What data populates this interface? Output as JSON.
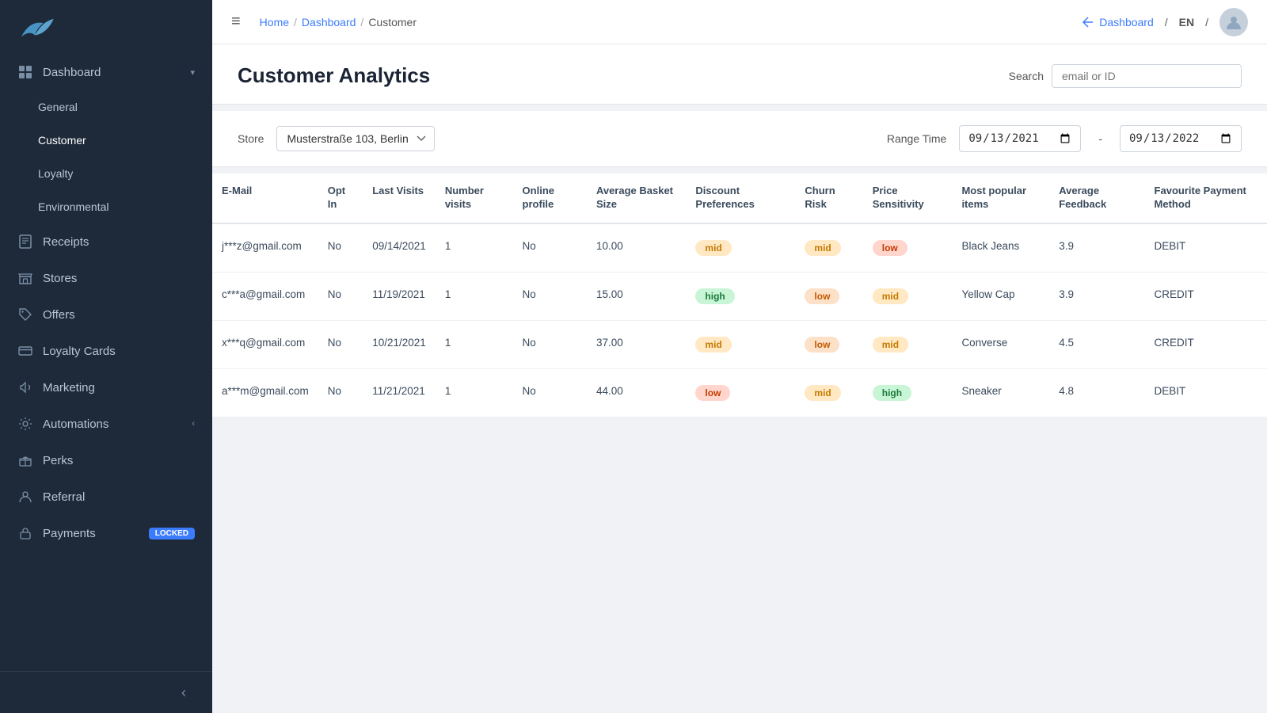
{
  "sidebar": {
    "logo_alt": "Swiftly logo",
    "nav": [
      {
        "id": "dashboard",
        "label": "Dashboard",
        "icon": "grid",
        "hasArrow": true,
        "active": false,
        "indent": 0
      },
      {
        "id": "general",
        "label": "General",
        "icon": "",
        "hasArrow": false,
        "active": false,
        "indent": 1
      },
      {
        "id": "customer",
        "label": "Customer",
        "icon": "",
        "hasArrow": false,
        "active": true,
        "indent": 1
      },
      {
        "id": "loyalty",
        "label": "Loyalty",
        "icon": "",
        "hasArrow": false,
        "active": false,
        "indent": 1
      },
      {
        "id": "environmental",
        "label": "Environmental",
        "icon": "",
        "hasArrow": false,
        "active": false,
        "indent": 1
      },
      {
        "id": "receipts",
        "label": "Receipts",
        "icon": "receipt",
        "hasArrow": false,
        "active": false,
        "indent": 0
      },
      {
        "id": "stores",
        "label": "Stores",
        "icon": "store",
        "hasArrow": false,
        "active": false,
        "indent": 0
      },
      {
        "id": "offers",
        "label": "Offers",
        "icon": "tag",
        "hasArrow": false,
        "active": false,
        "indent": 0
      },
      {
        "id": "loyalty-cards",
        "label": "Loyalty Cards",
        "icon": "card",
        "hasArrow": false,
        "active": false,
        "indent": 0
      },
      {
        "id": "marketing",
        "label": "Marketing",
        "icon": "megaphone",
        "hasArrow": false,
        "active": false,
        "indent": 0
      },
      {
        "id": "automations",
        "label": "Automations",
        "icon": "settings2",
        "hasArrow": true,
        "active": false,
        "indent": 0
      },
      {
        "id": "perks",
        "label": "Perks",
        "icon": "gift",
        "hasArrow": false,
        "active": false,
        "indent": 0
      },
      {
        "id": "referral",
        "label": "Referral",
        "icon": "person",
        "hasArrow": false,
        "active": false,
        "indent": 0
      },
      {
        "id": "payments",
        "label": "Payments",
        "icon": "lock",
        "hasArrow": false,
        "active": false,
        "indent": 0,
        "badge": "Locked"
      }
    ],
    "collapse_label": "‹"
  },
  "topbar": {
    "hamburger": "≡",
    "breadcrumb": [
      {
        "label": "Home",
        "link": true
      },
      {
        "label": "Dashboard",
        "link": true
      },
      {
        "label": "Customer",
        "link": false
      }
    ],
    "right": {
      "dashboard_link": "Dashboard",
      "lang": "EN",
      "separator": "/"
    }
  },
  "page": {
    "title": "Customer Analytics",
    "search_label": "Search",
    "search_placeholder": "email or ID"
  },
  "filter": {
    "store_label": "Store",
    "store_value": "Musterstraße 103, Berlin",
    "store_options": [
      "Musterstraße 103, Berlin"
    ],
    "range_label": "Range Time",
    "date_from": "09/13/2021",
    "date_to": "09/13/2022"
  },
  "table": {
    "columns": [
      "E-Mail",
      "Opt In",
      "Last Visits",
      "Number visits",
      "Online profile",
      "Average Basket Size",
      "Discount Preferences",
      "Churn Risk",
      "Price Sensitivity",
      "Most popular items",
      "Average Feedback",
      "Favourite Payment Method"
    ],
    "rows": [
      {
        "email": "j***z@gmail.com",
        "opt_in": "No",
        "last_visits": "09/14/2021",
        "number_visits": "1",
        "online_profile": "No",
        "avg_basket": "10.00",
        "discount_pref": "mid",
        "discount_pref_class": "badge-mid-orange",
        "churn_risk": "mid",
        "churn_risk_class": "badge-mid-orange",
        "price_sensitivity": "low",
        "price_sensitivity_class": "badge-low-red",
        "popular_items": "Black Jeans",
        "avg_feedback": "3.9",
        "payment_method": "DEBIT"
      },
      {
        "email": "c***a@gmail.com",
        "opt_in": "No",
        "last_visits": "11/19/2021",
        "number_visits": "1",
        "online_profile": "No",
        "avg_basket": "15.00",
        "discount_pref": "high",
        "discount_pref_class": "badge-high-green",
        "churn_risk": "low",
        "churn_risk_class": "badge-low-orange",
        "price_sensitivity": "mid",
        "price_sensitivity_class": "badge-mid-orange",
        "popular_items": "Yellow Cap",
        "avg_feedback": "3.9",
        "payment_method": "CREDIT"
      },
      {
        "email": "x***q@gmail.com",
        "opt_in": "No",
        "last_visits": "10/21/2021",
        "number_visits": "1",
        "online_profile": "No",
        "avg_basket": "37.00",
        "discount_pref": "mid",
        "discount_pref_class": "badge-mid-orange",
        "churn_risk": "low",
        "churn_risk_class": "badge-low-orange",
        "price_sensitivity": "mid",
        "price_sensitivity_class": "badge-mid-orange",
        "popular_items": "Converse",
        "avg_feedback": "4.5",
        "payment_method": "CREDIT"
      },
      {
        "email": "a***m@gmail.com",
        "opt_in": "No",
        "last_visits": "11/21/2021",
        "number_visits": "1",
        "online_profile": "No",
        "avg_basket": "44.00",
        "discount_pref": "low",
        "discount_pref_class": "badge-low-red",
        "churn_risk": "mid",
        "churn_risk_class": "badge-mid-orange",
        "price_sensitivity": "high",
        "price_sensitivity_class": "badge-high-green",
        "popular_items": "Sneaker",
        "avg_feedback": "4.8",
        "payment_method": "DEBIT"
      }
    ]
  }
}
